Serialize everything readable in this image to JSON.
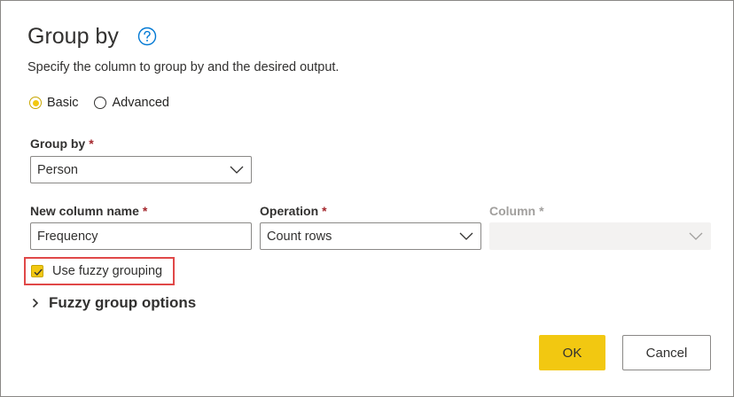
{
  "dialog": {
    "title": "Group by",
    "subtitle": "Specify the column to group by and the desired output."
  },
  "mode": {
    "options": [
      {
        "label": "Basic",
        "selected": true
      },
      {
        "label": "Advanced",
        "selected": false
      }
    ]
  },
  "group_by": {
    "label": "Group by",
    "required_marker": "*",
    "value": "Person"
  },
  "new_column": {
    "label": "New column name",
    "required_marker": "*",
    "value": "Frequency"
  },
  "operation": {
    "label": "Operation",
    "required_marker": "*",
    "value": "Count rows"
  },
  "column": {
    "label": "Column",
    "required_marker": "*",
    "value": "",
    "disabled": true
  },
  "fuzzy": {
    "checkbox_label": "Use fuzzy grouping",
    "checked": true,
    "options_label": "Fuzzy group options"
  },
  "buttons": {
    "ok": "OK",
    "cancel": "Cancel"
  },
  "colors": {
    "accent": "#f2c811",
    "help_icon": "#0078d4",
    "required": "#a4262c",
    "highlight_border": "#e04848"
  }
}
